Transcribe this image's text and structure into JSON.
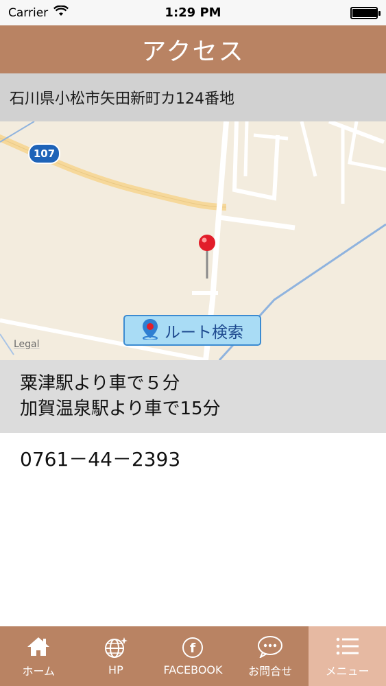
{
  "status": {
    "carrier": "Carrier",
    "time": "1:29 PM"
  },
  "header": {
    "title": "アクセス"
  },
  "address": "石川県小松市矢田新町カ124番地",
  "map": {
    "road_number": "107",
    "route_button_label": "ルート検索",
    "legal_label": "Legal"
  },
  "directions": {
    "line1": "粟津駅より車で５分",
    "line2": "加賀温泉駅より車で15分"
  },
  "phone": "0761－44－2393",
  "tabs": [
    {
      "label": "ホーム",
      "icon": "home-icon"
    },
    {
      "label": "HP",
      "icon": "globe-icon"
    },
    {
      "label": "FACEBOOK",
      "icon": "facebook-icon"
    },
    {
      "label": "お問合せ",
      "icon": "chat-icon"
    },
    {
      "label": "メニュー",
      "icon": "menu-icon"
    }
  ],
  "colors": {
    "header_bg": "#b98363",
    "tab_active": "#e6b9a2",
    "route_button_bg": "#a9dcf5"
  }
}
